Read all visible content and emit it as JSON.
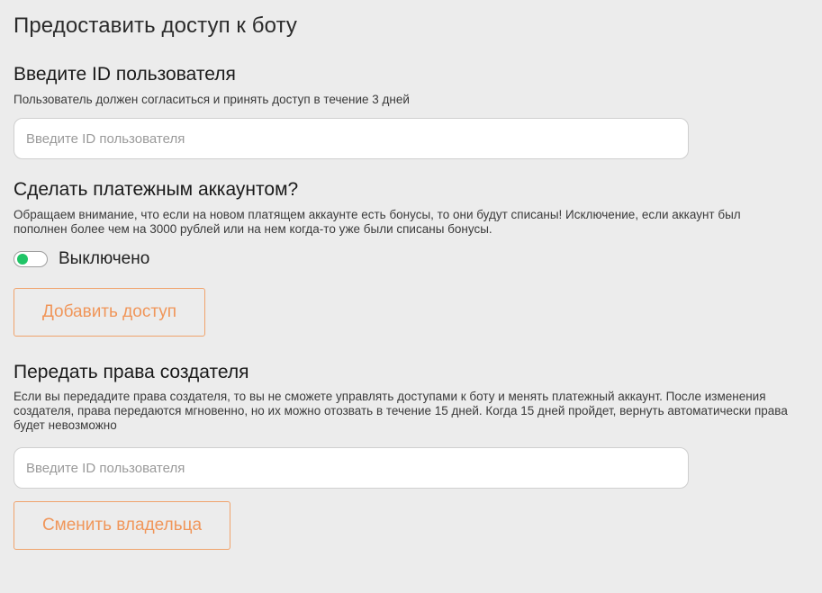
{
  "page": {
    "title": "Предоставить доступ к боту"
  },
  "user_access": {
    "title": "Введите ID пользователя",
    "description": "Пользователь должен согласиться и принять доступ в течение 3 дней",
    "input_placeholder": "Введите ID пользователя",
    "input_value": ""
  },
  "payment_account": {
    "title": "Сделать платежным аккаунтом?",
    "description": "Обращаем внимание, что если на новом платящем аккаунте есть бонусы, то они будут списаны! Исключение, если аккаунт был пополнен более чем на 3000 рублей или на нем когда-то уже были списаны бонусы.",
    "toggle_label": "Выключено",
    "toggle_color": "#1fc466"
  },
  "add_access_button": {
    "label": "Добавить доступ"
  },
  "transfer_owner": {
    "title": "Передать права создателя",
    "description": "Если вы передадите права создателя, то вы не сможете управлять доступами к боту и менять платежный аккаунт. После изменения создателя, права передаются мгновенно, но их можно отозвать в течение 15 дней. Когда 15 дней пройдет, вернуть автоматически права будет невозможно",
    "input_placeholder": "Введите ID пользователя",
    "input_value": "",
    "button_label": "Сменить владельца"
  },
  "colors": {
    "background": "#ececec",
    "accent": "#f0965a",
    "input_border": "#cfcfcf"
  }
}
